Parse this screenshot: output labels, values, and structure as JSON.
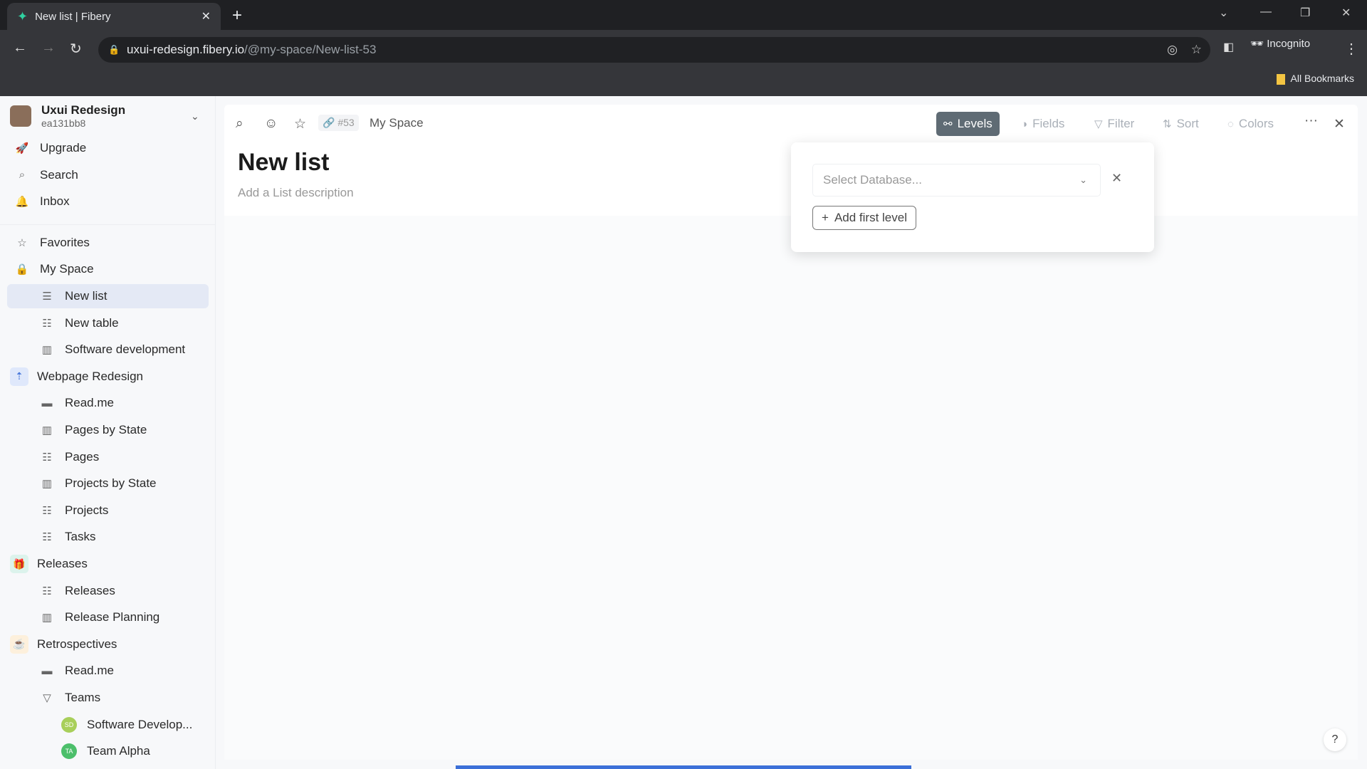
{
  "browser": {
    "tab_title": "New list | Fibery",
    "url_host": "uxui-redesign.fibery.io",
    "url_path": "/@my-space/New-list-53",
    "profile": "Incognito",
    "bookmarks": "All Bookmarks"
  },
  "workspace": {
    "name": "Uxui Redesign",
    "id": "ea131bb8"
  },
  "sidebar": {
    "items": [
      {
        "label": "Upgrade",
        "icon": "rocket-icon",
        "glyph": "🚀",
        "level": 1
      },
      {
        "label": "Search",
        "icon": "search-icon",
        "glyph": "⌕",
        "level": 1
      },
      {
        "label": "Inbox",
        "icon": "bell-icon",
        "glyph": "🔔",
        "level": 1
      },
      {
        "label": "Favorites",
        "icon": "star-icon",
        "glyph": "☆",
        "level": 1,
        "gap": true
      },
      {
        "label": "My Space",
        "icon": "lock-icon",
        "glyph": "🔒",
        "level": 1
      },
      {
        "label": "New list",
        "icon": "list-icon",
        "glyph": "☰",
        "level": 2,
        "selected": true
      },
      {
        "label": "New table",
        "icon": "table-icon",
        "glyph": "☷",
        "level": 2
      },
      {
        "label": "Software development",
        "icon": "board-icon",
        "glyph": "▥",
        "level": 2
      },
      {
        "label": "Webpage Redesign",
        "icon": "space-icon",
        "glyph": "⇡",
        "level": 1,
        "square": "#dfe8fb",
        "color": "#3569d6"
      },
      {
        "label": "Read.me",
        "icon": "document-icon",
        "glyph": "▬",
        "level": 2
      },
      {
        "label": "Pages by State",
        "icon": "board-icon",
        "glyph": "▥",
        "level": 2
      },
      {
        "label": "Pages",
        "icon": "table-icon",
        "glyph": "☷",
        "level": 2
      },
      {
        "label": "Projects by State",
        "icon": "board-icon",
        "glyph": "▥",
        "level": 2
      },
      {
        "label": "Projects",
        "icon": "table-icon",
        "glyph": "☷",
        "level": 2
      },
      {
        "label": "Tasks",
        "icon": "table-icon",
        "glyph": "☷",
        "level": 2
      },
      {
        "label": "Releases",
        "icon": "gift-icon",
        "glyph": "🎁",
        "level": 1,
        "square": "#dcf3ec",
        "color": "#1aa37a"
      },
      {
        "label": "Releases",
        "icon": "table-icon",
        "glyph": "☷",
        "level": 2
      },
      {
        "label": "Release Planning",
        "icon": "board-icon",
        "glyph": "▥",
        "level": 2
      },
      {
        "label": "Retrospectives",
        "icon": "retro-icon",
        "glyph": "☕",
        "level": 1,
        "square": "#fdf0dc",
        "color": "#e08a16"
      },
      {
        "label": "Read.me",
        "icon": "document-icon",
        "glyph": "▬",
        "level": 2
      },
      {
        "label": "Teams",
        "icon": "triangle-down-icon",
        "glyph": "▽",
        "level": 2
      },
      {
        "label": "Software Develop...",
        "badge": "SD",
        "badge_color": "#a8cf5a",
        "level": 3
      },
      {
        "label": "Team Alpha",
        "badge": "TA",
        "badge_color": "#4cbf6b",
        "level": 3
      }
    ]
  },
  "header": {
    "entity_id": "#53",
    "breadcrumb": "My Space"
  },
  "page": {
    "title": "New list",
    "description_placeholder": "Add a List description"
  },
  "toolbar": {
    "levels": "Levels",
    "fields": "Fields",
    "filter": "Filter",
    "sort": "Sort",
    "colors": "Colors"
  },
  "popup": {
    "select_placeholder": "Select Database...",
    "add_level": "Add first level"
  },
  "colors": {
    "accent": "#5f6b74",
    "progress": "#3b6fd8"
  }
}
